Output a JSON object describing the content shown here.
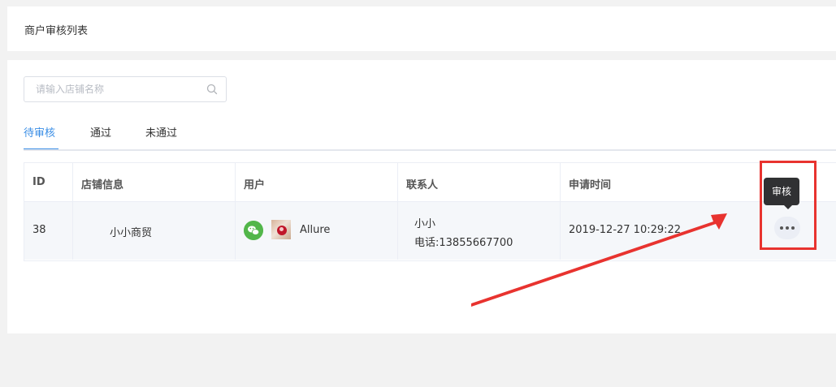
{
  "header": {
    "title": "商户审核列表"
  },
  "search": {
    "placeholder": "请输入店铺名称",
    "value": ""
  },
  "tabs": [
    {
      "label": "待审核",
      "active": true
    },
    {
      "label": "通过",
      "active": false
    },
    {
      "label": "未通过",
      "active": false
    }
  ],
  "table": {
    "columns": [
      "ID",
      "店铺信息",
      "用户",
      "联系人",
      "申请时间"
    ],
    "rows": [
      {
        "id": "38",
        "shop": "小小商贸",
        "user": {
          "icon": "wechat-icon",
          "name": "Allure"
        },
        "contact": {
          "name": "小小",
          "phone": "电话:13855667700"
        },
        "time": "2019-12-27 10:29:22"
      }
    ]
  },
  "tooltip": {
    "label": "审核"
  },
  "colors": {
    "accent": "#3a8ee6",
    "annotation": "#e8332f",
    "wechat": "#52b64a"
  }
}
